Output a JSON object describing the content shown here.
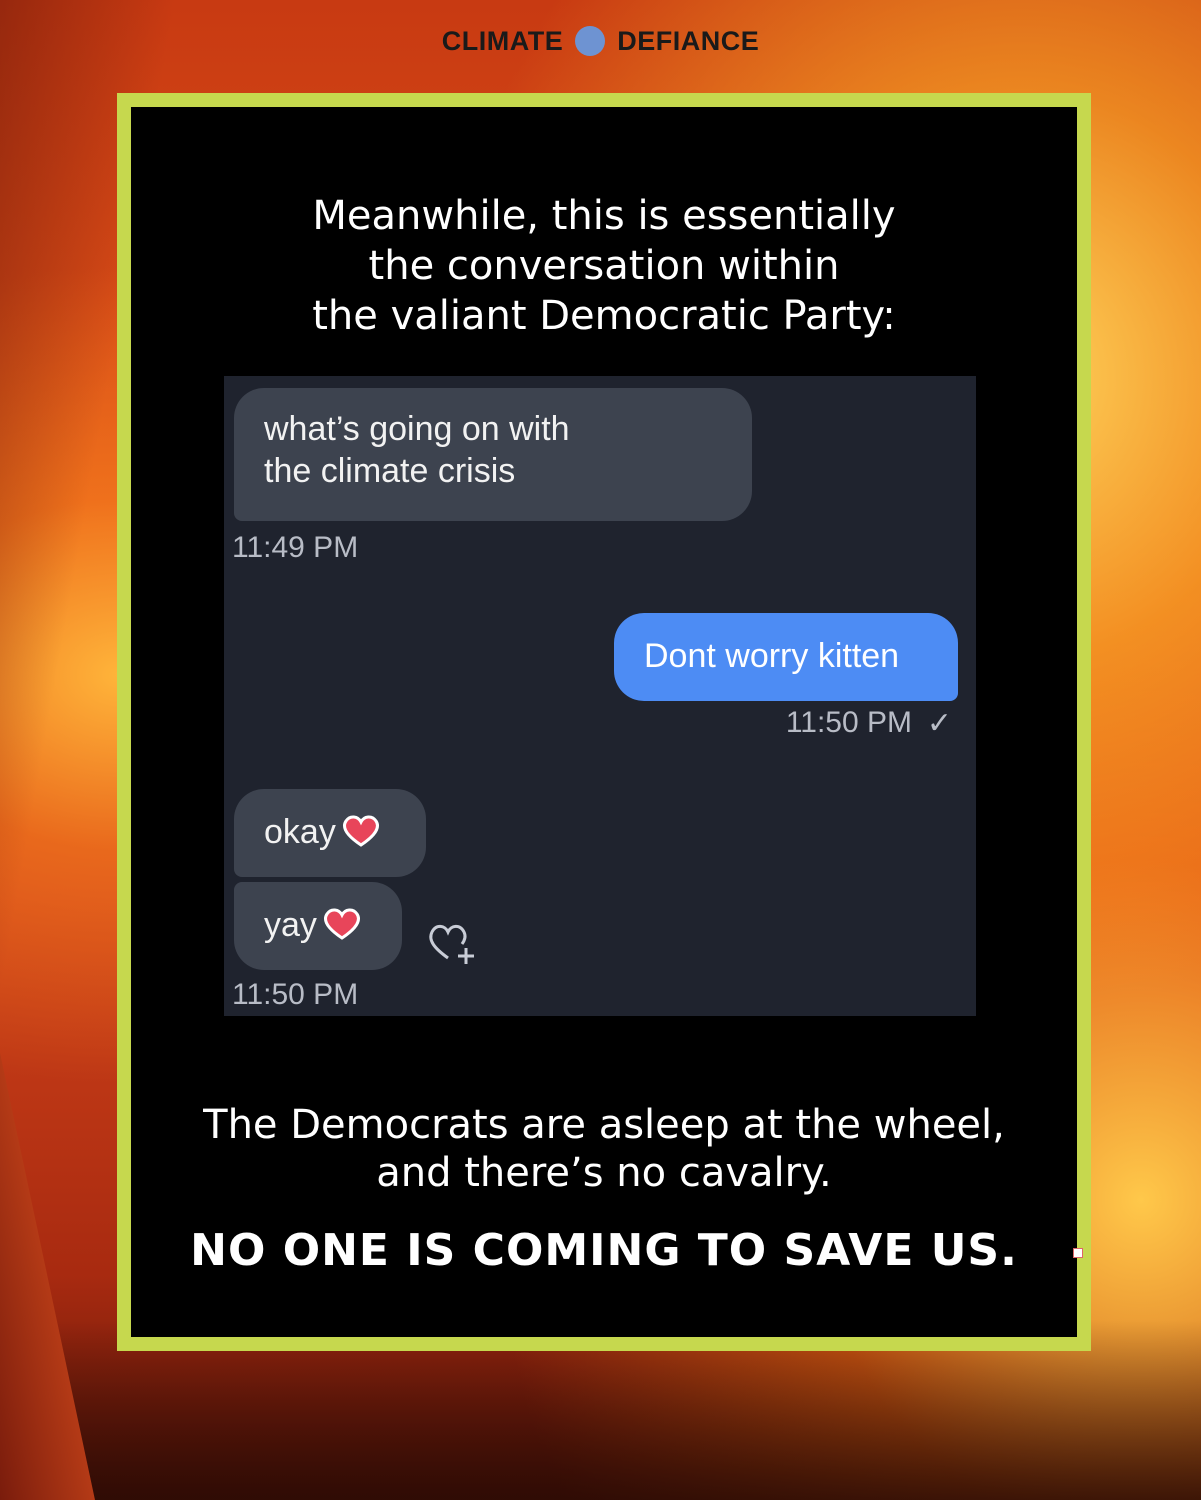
{
  "brand": {
    "left": "CLIMATE",
    "right": "DEFIANCE",
    "dot_color": "#6e93d2"
  },
  "intro": {
    "line1": "Meanwhile, this is essentially",
    "line2": "the conversation within",
    "line3": "the valiant Democratic Party:"
  },
  "chat": {
    "messages": [
      {
        "from": "them",
        "line1": "what’s going on with",
        "line2": "the climate crisis",
        "time": "11:49 PM"
      },
      {
        "from": "me",
        "text": "Dont worry kitten",
        "time": "11:50 PM",
        "status": "✓"
      },
      {
        "from": "them",
        "text": "okay",
        "icon": "heart-icon"
      },
      {
        "from": "them",
        "text": "yay",
        "icon": "heart-icon",
        "time": "11:50 PM"
      }
    ]
  },
  "outro": {
    "line1": "The Democrats are asleep at the wheel,",
    "line2": "and there’s no cavalry."
  },
  "cta": "NO ONE IS COMING TO SAVE US.",
  "colors": {
    "frame": "#c6d84e",
    "panel": "#000000",
    "chat_bg": "#1f232e",
    "bubble_in": "#3d434f",
    "bubble_out": "#4d8cf4",
    "heart": "#e8455a"
  }
}
